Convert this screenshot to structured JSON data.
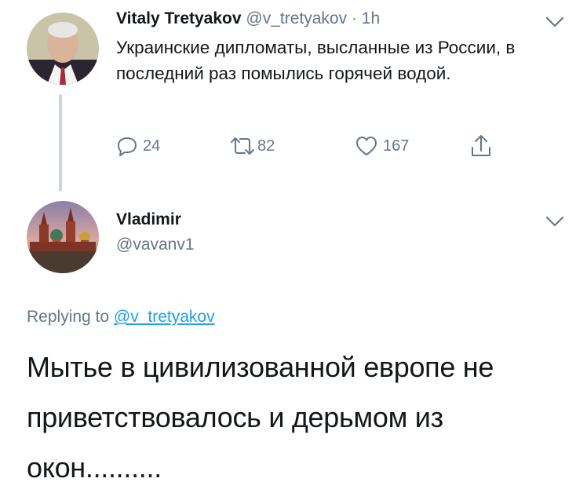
{
  "original_tweet": {
    "author_name": "Vitaly Tretyakov",
    "handle": "@v_tretyakov",
    "separator": "·",
    "time": "1h",
    "text": "Украинские дипломаты, высланные из России, в последний раз помылись горячей водой.",
    "reply_count": "24",
    "retweet_count": "82",
    "like_count": "167",
    "icons": {
      "reply": "reply-icon",
      "retweet": "retweet-icon",
      "like": "heart-icon",
      "share": "share-icon",
      "menu": "chevron-down-icon"
    }
  },
  "reply_tweet": {
    "author_name": "Vladimir",
    "handle": "@vavanv1",
    "replying_prefix": "Replying to",
    "replying_to": "@v_tretyakov",
    "text": "Мытье в цивилизованной европе не приветствовалось и дерьмом из окон.........."
  },
  "colors": {
    "text": "#14171a",
    "muted": "#657786",
    "link": "#1da1f2",
    "thread_line": "#ccd6dd"
  }
}
